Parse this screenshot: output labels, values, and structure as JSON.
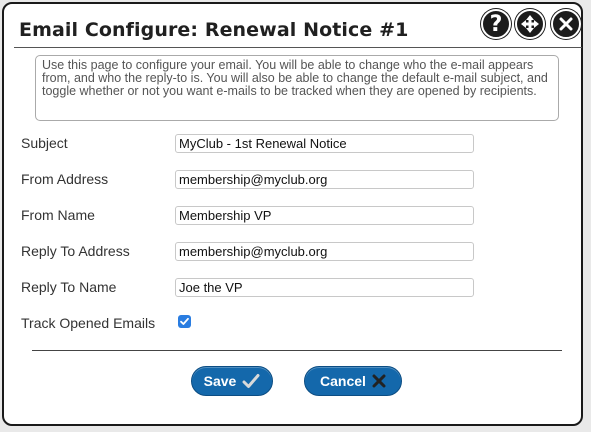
{
  "dialog": {
    "title": "Email Configure: Renewal Notice #1",
    "controls": {
      "help": "?"
    },
    "info": "Use this page to configure your email. You will be able to change who the e-mail appears from, and who the reply-to is. You will also be able to change the default e-mail subject, and toggle whether or not you want e-mails to be tracked when they are opened by recipients."
  },
  "form": {
    "subject": {
      "label": "Subject",
      "value": "MyClub - 1st Renewal Notice"
    },
    "from_address": {
      "label": "From Address",
      "value": "membership@myclub.org"
    },
    "from_name": {
      "label": "From Name",
      "value": "Membership VP"
    },
    "reply_to_address": {
      "label": "Reply To Address",
      "value": "membership@myclub.org"
    },
    "reply_to_name": {
      "label": "Reply To Name",
      "value": "Joe the VP"
    },
    "track_opened": {
      "label": "Track Opened Emails",
      "checked": true
    }
  },
  "buttons": {
    "save": {
      "label": "Save",
      "icon": "check-icon"
    },
    "cancel": {
      "label": "Cancel",
      "icon": "x-icon"
    }
  },
  "colors": {
    "button_blue": "#1468ab",
    "checkbox_blue": "#2a7de1",
    "title_bar_icons": "#1c1c1c"
  }
}
